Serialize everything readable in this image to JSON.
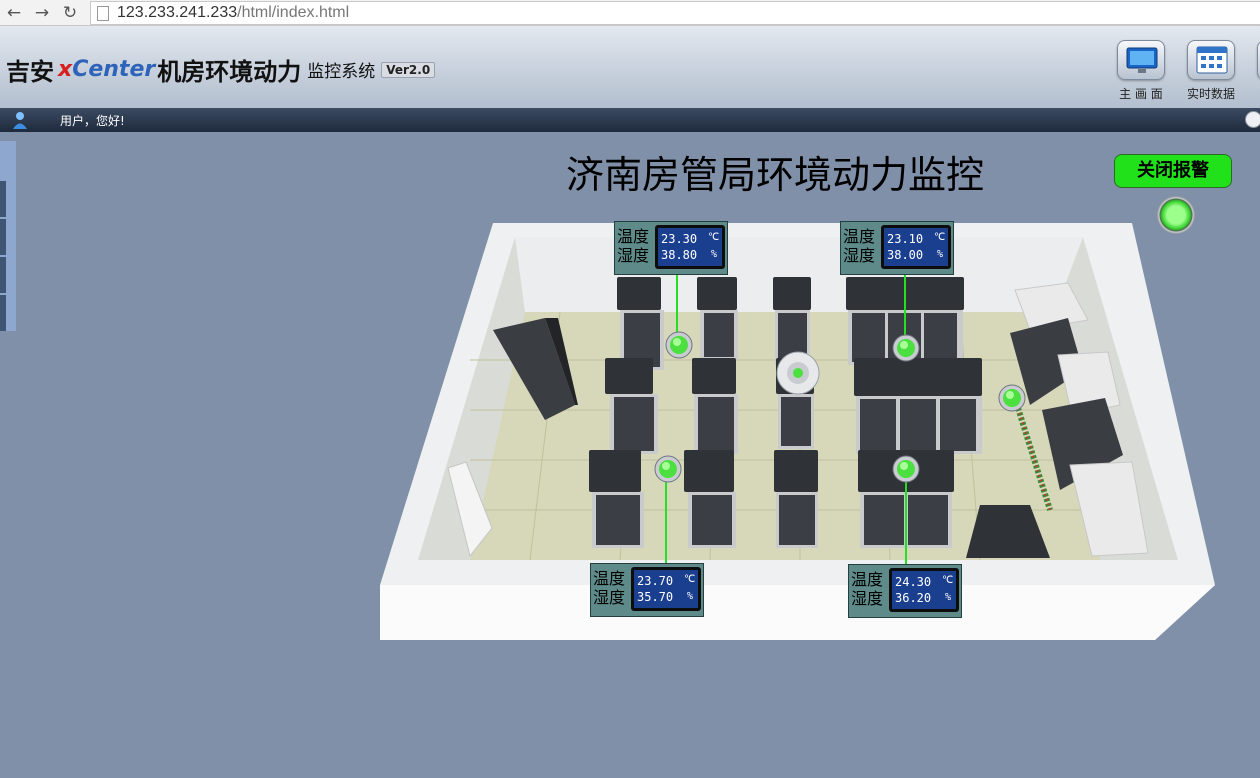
{
  "browser": {
    "url_host": "123.233.241.233",
    "url_path": "/html/index.html"
  },
  "header": {
    "brand_prefix": "吉安",
    "brand_x": "x",
    "brand_center": "Center",
    "app_name": "机房环境动力",
    "app_sub": "监控系统",
    "version": "Ver2.0",
    "buttons": [
      {
        "label": "主 画 面",
        "icon": "monitor-icon"
      },
      {
        "label": "实时数据",
        "icon": "grid-icon"
      }
    ]
  },
  "user_bar": {
    "greeting": "用户，您好!"
  },
  "page": {
    "title": "济南房管局环境动力监控",
    "alarm_button": "关闭报警",
    "alarm_status": "normal",
    "status_color": "#34d02a"
  },
  "sensors": [
    {
      "id": "sensor-1",
      "temp_label": "温度",
      "hum_label": "湿度",
      "temperature": "23.30",
      "temp_unit": "℃",
      "humidity": "38.80",
      "hum_unit": "%"
    },
    {
      "id": "sensor-2",
      "temp_label": "温度",
      "hum_label": "湿度",
      "temperature": "23.10",
      "temp_unit": "℃",
      "humidity": "38.00",
      "hum_unit": "%"
    },
    {
      "id": "sensor-3",
      "temp_label": "温度",
      "hum_label": "湿度",
      "temperature": "23.70",
      "temp_unit": "℃",
      "humidity": "35.70",
      "hum_unit": "%"
    },
    {
      "id": "sensor-4",
      "temp_label": "温度",
      "hum_label": "湿度",
      "temperature": "24.30",
      "temp_unit": "℃",
      "humidity": "36.20",
      "hum_unit": "%"
    }
  ],
  "colors": {
    "lcd_background": "#1b3f8f",
    "sensor_panel": "#5e8b8a",
    "alarm_button": "#21e21a",
    "link_line": "#25e021",
    "rack": "#2f3236"
  }
}
